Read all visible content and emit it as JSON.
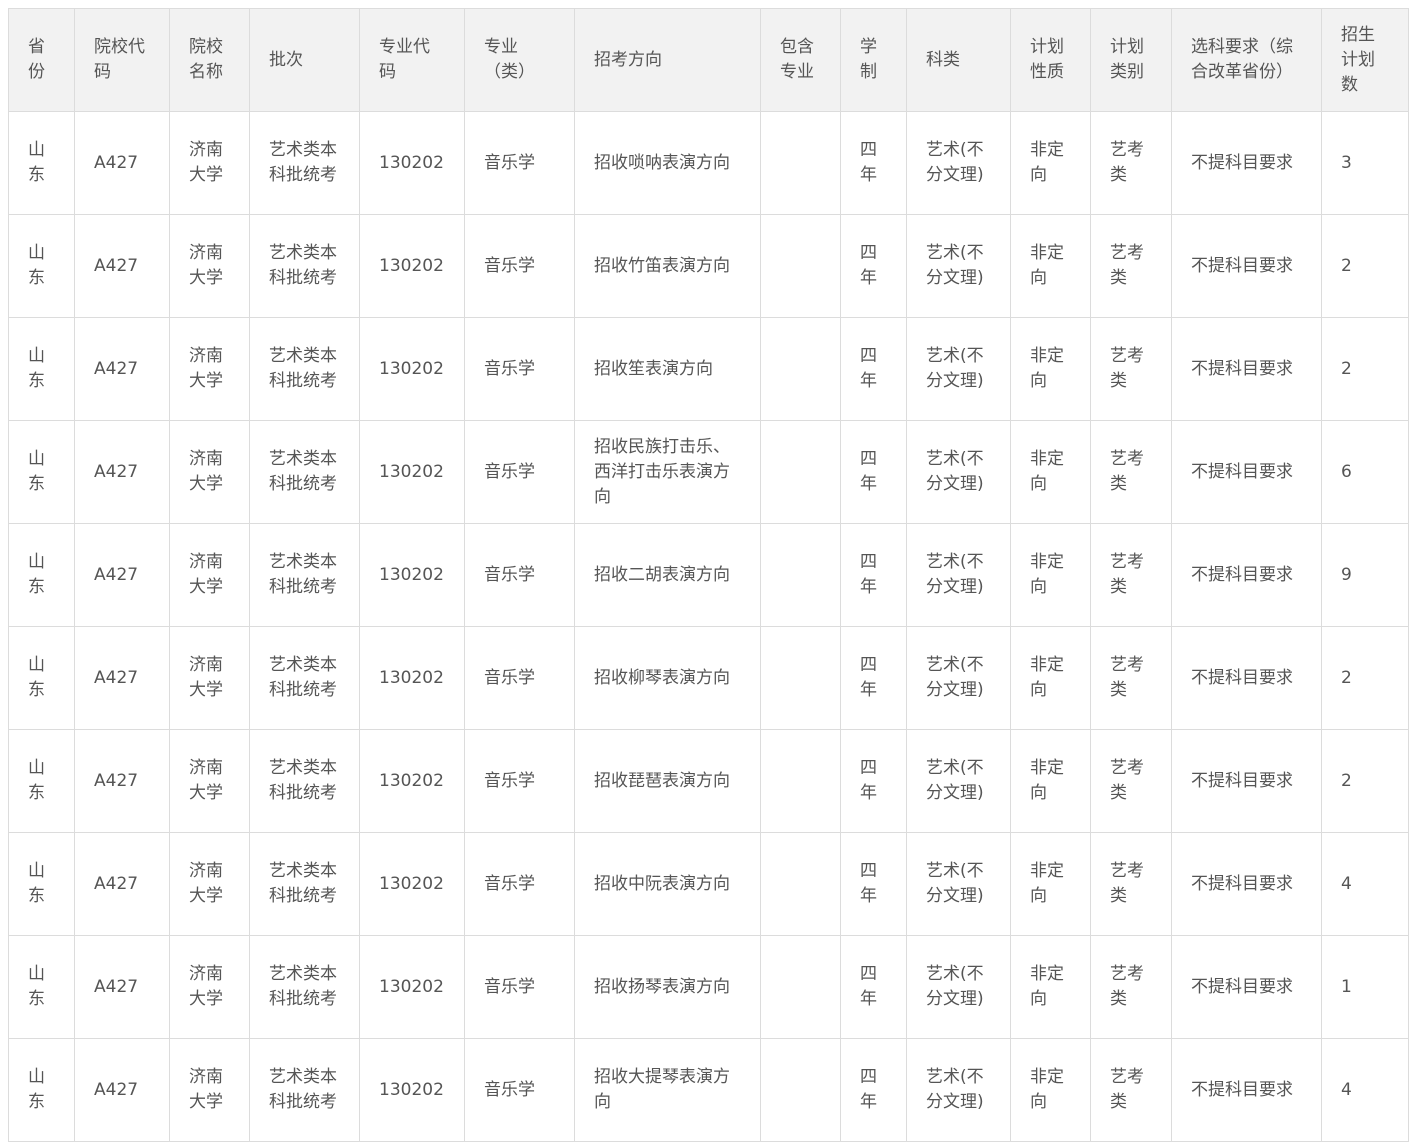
{
  "table": {
    "headers": [
      "省份",
      "院校代码",
      "院校名称",
      "批次",
      "专业代码",
      "专业（类）",
      "招考方向",
      "包含专业",
      "学制",
      "科类",
      "计划性质",
      "计划类别",
      "选科要求（综合改革省份）",
      "招生计划数"
    ],
    "rows": [
      [
        "山东",
        "A427",
        "济南大学",
        "艺术类本科批统考",
        "130202",
        "音乐学",
        "招收唢呐表演方向",
        "",
        "四年",
        "艺术(不分文理)",
        "非定向",
        "艺考类",
        "不提科目要求",
        "3"
      ],
      [
        "山东",
        "A427",
        "济南大学",
        "艺术类本科批统考",
        "130202",
        "音乐学",
        "招收竹笛表演方向",
        "",
        "四年",
        "艺术(不分文理)",
        "非定向",
        "艺考类",
        "不提科目要求",
        "2"
      ],
      [
        "山东",
        "A427",
        "济南大学",
        "艺术类本科批统考",
        "130202",
        "音乐学",
        "招收笙表演方向",
        "",
        "四年",
        "艺术(不分文理)",
        "非定向",
        "艺考类",
        "不提科目要求",
        "2"
      ],
      [
        "山东",
        "A427",
        "济南大学",
        "艺术类本科批统考",
        "130202",
        "音乐学",
        "招收民族打击乐、西洋打击乐表演方向",
        "",
        "四年",
        "艺术(不分文理)",
        "非定向",
        "艺考类",
        "不提科目要求",
        "6"
      ],
      [
        "山东",
        "A427",
        "济南大学",
        "艺术类本科批统考",
        "130202",
        "音乐学",
        "招收二胡表演方向",
        "",
        "四年",
        "艺术(不分文理)",
        "非定向",
        "艺考类",
        "不提科目要求",
        "9"
      ],
      [
        "山东",
        "A427",
        "济南大学",
        "艺术类本科批统考",
        "130202",
        "音乐学",
        "招收柳琴表演方向",
        "",
        "四年",
        "艺术(不分文理)",
        "非定向",
        "艺考类",
        "不提科目要求",
        "2"
      ],
      [
        "山东",
        "A427",
        "济南大学",
        "艺术类本科批统考",
        "130202",
        "音乐学",
        "招收琵琶表演方向",
        "",
        "四年",
        "艺术(不分文理)",
        "非定向",
        "艺考类",
        "不提科目要求",
        "2"
      ],
      [
        "山东",
        "A427",
        "济南大学",
        "艺术类本科批统考",
        "130202",
        "音乐学",
        "招收中阮表演方向",
        "",
        "四年",
        "艺术(不分文理)",
        "非定向",
        "艺考类",
        "不提科目要求",
        "4"
      ],
      [
        "山东",
        "A427",
        "济南大学",
        "艺术类本科批统考",
        "130202",
        "音乐学",
        "招收扬琴表演方向",
        "",
        "四年",
        "艺术(不分文理)",
        "非定向",
        "艺考类",
        "不提科目要求",
        "1"
      ],
      [
        "山东",
        "A427",
        "济南大学",
        "艺术类本科批统考",
        "130202",
        "音乐学",
        "招收大提琴表演方向",
        "",
        "四年",
        "艺术(不分文理)",
        "非定向",
        "艺考类",
        "不提科目要求",
        "4"
      ]
    ]
  }
}
